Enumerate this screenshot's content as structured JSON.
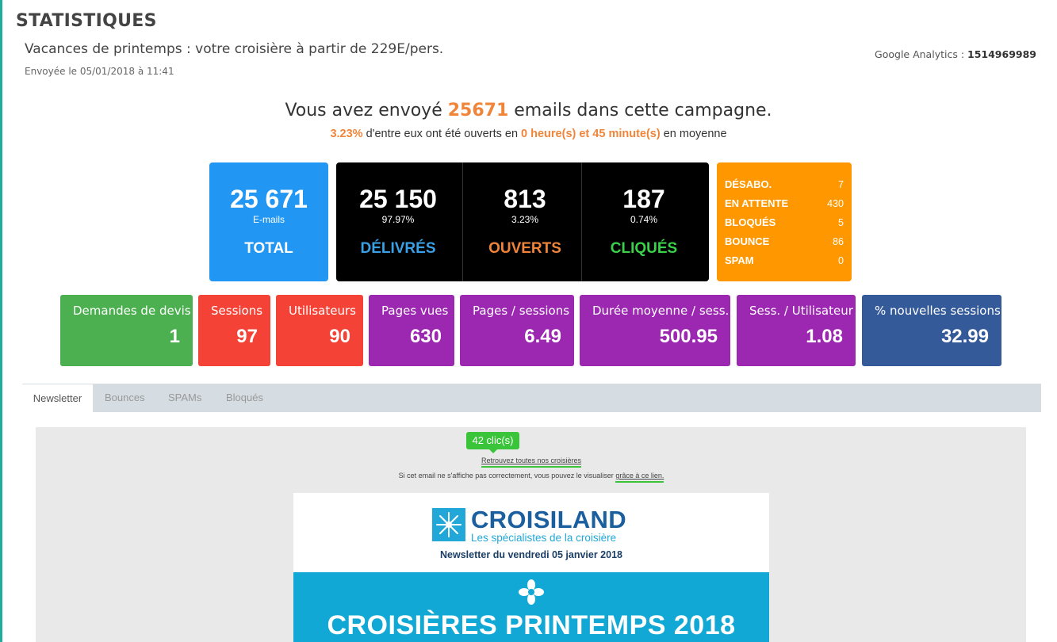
{
  "header": {
    "title": "STATISTIQUES",
    "subject": "Vacances de printemps : votre croisière à partir de 229E/pers.",
    "sent": "Envoyée le 05/01/2018 à 11:41",
    "ga_label": "Google Analytics : ",
    "ga_id": "1514969989"
  },
  "summary": {
    "line1_pre": "Vous avez envoyé ",
    "emails_sent": "25671",
    "line1_post": " emails dans cette campagne.",
    "open_rate": "3.23%",
    "line2_mid": " d'entre eux ont été ouverts en ",
    "avg_time": "0 heure(s) et 45 minute(s)",
    "line2_post": " en moyenne"
  },
  "stats": {
    "total": {
      "value": "25 671",
      "sub": "E-mails",
      "label": "TOTAL"
    },
    "delivered": {
      "value": "25 150",
      "sub": "97.97%",
      "label": "DÉLIVRÉS",
      "color": "#3aa0e6"
    },
    "opened": {
      "value": "813",
      "sub": "3.23%",
      "label": "OUVERTS",
      "color": "#f0853a"
    },
    "clicked": {
      "value": "187",
      "sub": "0.74%",
      "label": "CLIQUÉS",
      "color": "#3ad14a"
    },
    "other": [
      {
        "label": "DÉSABO.",
        "value": "7"
      },
      {
        "label": "EN ATTENTE",
        "value": "430"
      },
      {
        "label": "BLOQUÉS",
        "value": "5"
      },
      {
        "label": "BOUNCE",
        "value": "86"
      },
      {
        "label": "SPAM",
        "value": "0"
      }
    ]
  },
  "metrics": [
    {
      "title": "Demandes de devis",
      "value": "1",
      "color": "#4caf50"
    },
    {
      "title": "Sessions",
      "value": "97",
      "color": "#f44336"
    },
    {
      "title": "Utilisateurs",
      "value": "90",
      "color": "#f44336"
    },
    {
      "title": "Pages vues",
      "value": "630",
      "color": "#9c27b0"
    },
    {
      "title": "Pages / sessions",
      "value": "6.49",
      "color": "#9c27b0"
    },
    {
      "title": "Durée moyenne / sess.",
      "value": "500.95",
      "color": "#9c27b0"
    },
    {
      "title": "Sess. / Utilisateur",
      "value": "1.08",
      "color": "#9c27b0"
    },
    {
      "title": "% nouvelles sessions",
      "value": "32.99",
      "color": "#355a9a"
    }
  ],
  "tabs": [
    "Newsletter",
    "Bounces",
    "SPAMs",
    "Bloqués"
  ],
  "preview": {
    "clicks_badge": "42 clic(s)",
    "link_croisieres": "Retrouvez toutes nos croisières",
    "display_text": "Si cet email ne s'affiche pas correctement, vous pouvez le visualiser ",
    "display_link": "grâce à ce lien.",
    "brand": "CROISILAND",
    "tagline": "Les spécialistes de la croisière",
    "newsletter_date": "Newsletter du vendredi 05 janvier 2018",
    "banner_title": "CROISIÈRES PRINTEMPS 2018"
  }
}
